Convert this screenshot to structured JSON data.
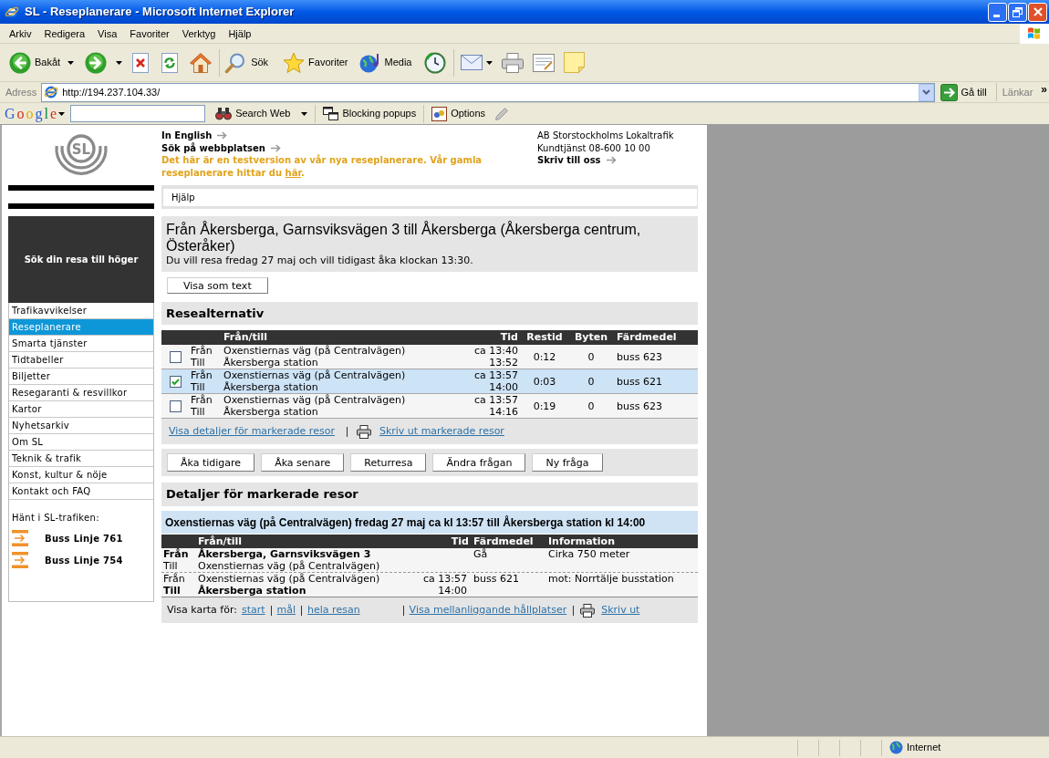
{
  "window": {
    "title": "SL - Reseplanerare - Microsoft Internet Explorer"
  },
  "menu_bar": [
    "Arkiv",
    "Redigera",
    "Visa",
    "Favoriter",
    "Verktyg",
    "Hjälp"
  ],
  "toolbar": {
    "back": "Bakåt",
    "search": "Sök",
    "favorites": "Favoriter",
    "media": "Media"
  },
  "address_bar": {
    "label": "Adress",
    "url": "http://194.237.104.33/",
    "go": "Gå till",
    "links": "Länkar",
    "more": "»"
  },
  "google_toolbar": {
    "logo": "Google",
    "search_web": "Search Web",
    "popups": "Blocking popups",
    "options": "Options"
  },
  "sidebar": {
    "logo": "SL",
    "tagline": "Sök din resa till höger",
    "nav": [
      {
        "label": "Trafikavvikelser",
        "selected": false
      },
      {
        "label": "Reseplanerare",
        "selected": true
      },
      {
        "label": "Smarta tjänster",
        "selected": false
      },
      {
        "label": "Tidtabeller",
        "selected": false
      },
      {
        "label": "Biljetter",
        "selected": false
      },
      {
        "label": "Resegaranti & resvillkor",
        "selected": false
      },
      {
        "label": "Kartor",
        "selected": false
      },
      {
        "label": "Nyhetsarkiv",
        "selected": false
      },
      {
        "label": "Om SL",
        "selected": false
      },
      {
        "label": "Teknik & trafik",
        "selected": false
      },
      {
        "label": "Konst, kultur & nöje",
        "selected": false
      },
      {
        "label": "Kontakt och FAQ",
        "selected": false
      }
    ],
    "news_heading": "Hänt i SL-trafiken:",
    "news": [
      "Buss Linje 761",
      "Buss Linje 754"
    ]
  },
  "header": {
    "links": [
      "In English",
      "Sök på webbplatsen"
    ],
    "notice": {
      "text": "Det här är en testversion av vår nya reseplanerare. Vår gamla reseplanerare hittar du ",
      "link": "här",
      "end": "."
    },
    "contact": {
      "company": "AB Storstockholms Lokaltrafik",
      "phone": "Kundtjänst 08-600 10 00",
      "write": "Skriv till oss"
    }
  },
  "help_bar": {
    "label": "Hjälp"
  },
  "journey": {
    "title": "Från Åkersberga, Garnsviksvägen 3 till Åkersberga (Åkersberga centrum, Österåker)",
    "subtitle": "Du vill resa fredag 27 maj och vill tidigast åka klockan 13:30.",
    "text_view_button": "Visa som text"
  },
  "alternatives": {
    "heading": "Resealternativ",
    "columns": [
      "Från/till",
      "Tid",
      "Restid",
      "Byten",
      "Färdmedel"
    ],
    "rows": [
      {
        "checked": false,
        "selected": false,
        "from_label": "Från",
        "to_label": "Till",
        "from": "Oxenstiernas väg (på Centralvägen)",
        "to": "Åkersberga station",
        "departure": "ca 13:40",
        "arrival": "13:52",
        "duration": "0:12",
        "changes": "0",
        "vehicle": "buss 623"
      },
      {
        "checked": true,
        "selected": true,
        "from_label": "Från",
        "to_label": "Till",
        "from": "Oxenstiernas väg (på Centralvägen)",
        "to": "Åkersberga station",
        "departure": "ca 13:57",
        "arrival": "14:00",
        "duration": "0:03",
        "changes": "0",
        "vehicle": "buss 621"
      },
      {
        "checked": false,
        "selected": false,
        "from_label": "Från",
        "to_label": "Till",
        "from": "Oxenstiernas väg (på Centralvägen)",
        "to": "Åkersberga station",
        "departure": "ca 13:57",
        "arrival": "14:16",
        "duration": "0:19",
        "changes": "0",
        "vehicle": "buss 623"
      }
    ],
    "links": [
      {
        "kind": "link",
        "label": "Visa detaljer för markerade resor"
      },
      {
        "kind": "print",
        "label": "Skriv ut markerade resor"
      }
    ]
  },
  "buttons": [
    "Åka tidigare",
    "Åka senare",
    "Returresa",
    "Ändra frågan",
    "Ny fråga"
  ],
  "details": {
    "heading": "Detaljer för markerade resor",
    "summary": "Oxenstiernas väg (på Centralvägen) fredag 27 maj ca kl 13:57 till Åkersberga station kl 14:00",
    "columns": [
      "Från/till",
      "Tid",
      "Färdmedel",
      "Information"
    ],
    "legs": [
      {
        "from": {
          "label": "Från",
          "place": "Åkersberga, Garnsviksvägen 3",
          "emphasized": true
        },
        "to": {
          "label": "Till",
          "place": "Oxenstiernas väg (på Centralvägen)",
          "emphasized": false
        },
        "mode": "Gå",
        "info": "Cirka 750 meter"
      },
      {
        "from": {
          "label": "Från",
          "place": "Oxenstiernas väg (på Centralvägen)",
          "time": "ca 13:57",
          "emphasized": false
        },
        "to": {
          "label": "Till",
          "place": "Åkersberga station",
          "time": "14:00",
          "emphasized": true
        },
        "mode": "buss 621",
        "info": "mot: Norrtälje busstation"
      }
    ],
    "footer": {
      "map_label": "Visa karta för:",
      "map_links": [
        "start",
        "mål",
        "hela resan"
      ],
      "stops_link": "Visa mellanliggande hållplatser",
      "print_link": "Skriv ut"
    }
  },
  "status_bar": {
    "zone": "Internet"
  }
}
